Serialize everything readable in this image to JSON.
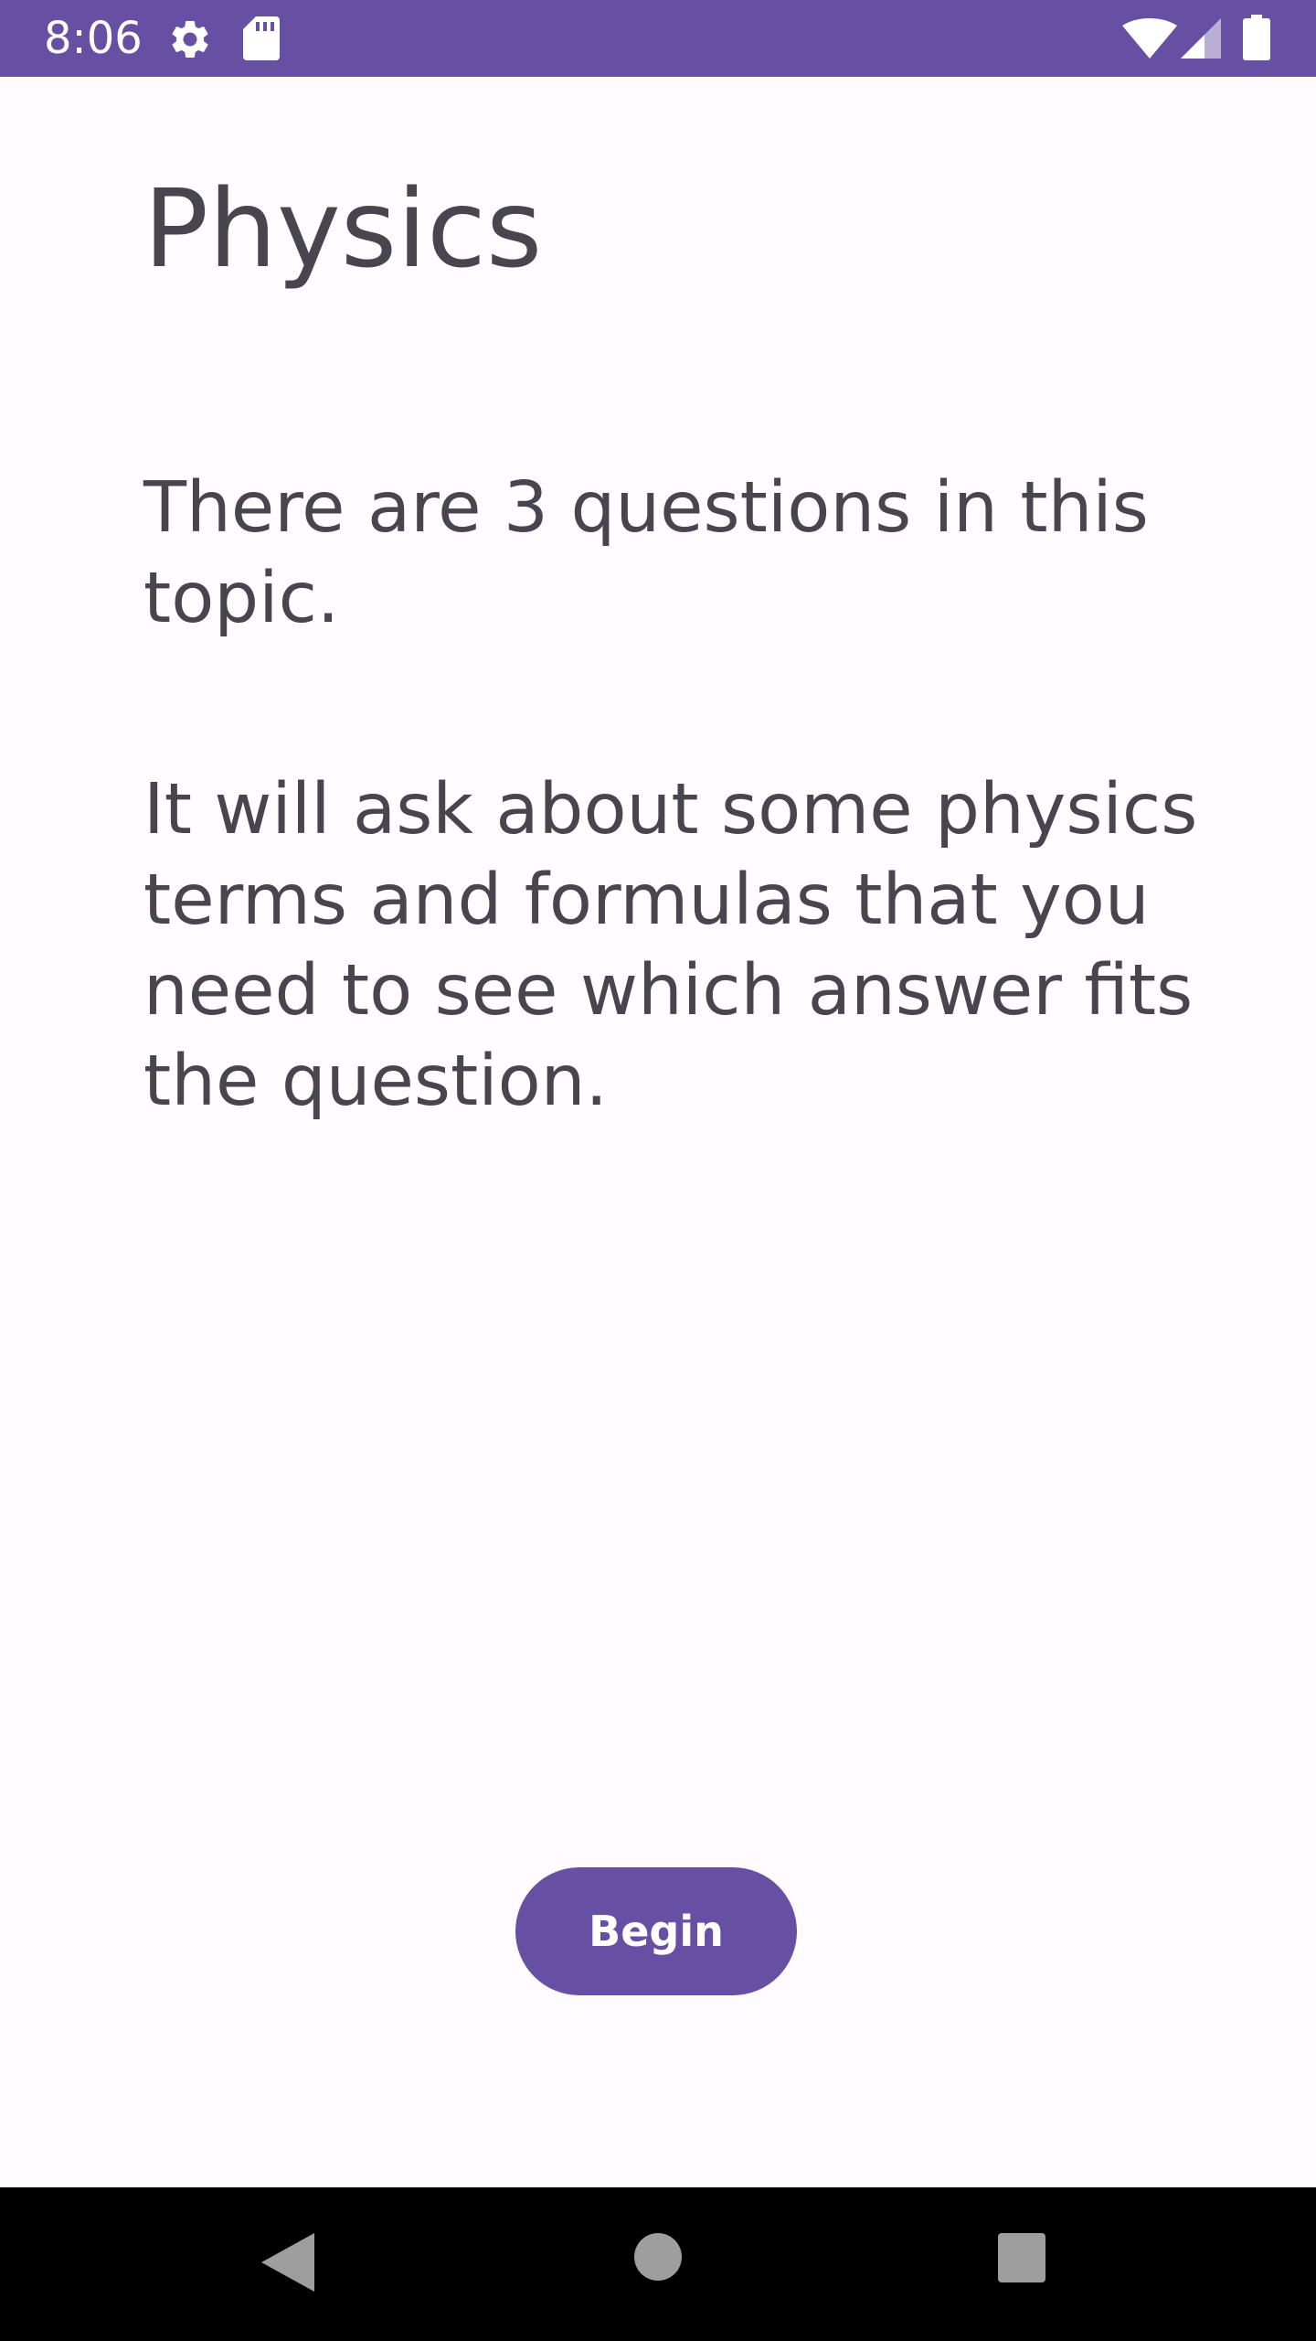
{
  "status_bar": {
    "time": "8:06",
    "background_color": "#6750A4",
    "left_icons": [
      "settings-gear-icon",
      "sd-card-icon"
    ],
    "right_icons": [
      "wifi-icon",
      "cell-signal-icon",
      "battery-icon"
    ]
  },
  "screen": {
    "title": "Physics",
    "paragraphs": [
      "There are 3 questions in this topic.",
      "It will ask about some physics terms and formulas that you need to see which answer fits the question."
    ],
    "begin_button_label": "Begin",
    "accent_color": "#6750A4",
    "text_color": "#49454F",
    "background_color": "#FFFBFE"
  },
  "navigation_bar": {
    "buttons": [
      "back-icon",
      "home-icon",
      "recents-icon"
    ]
  }
}
